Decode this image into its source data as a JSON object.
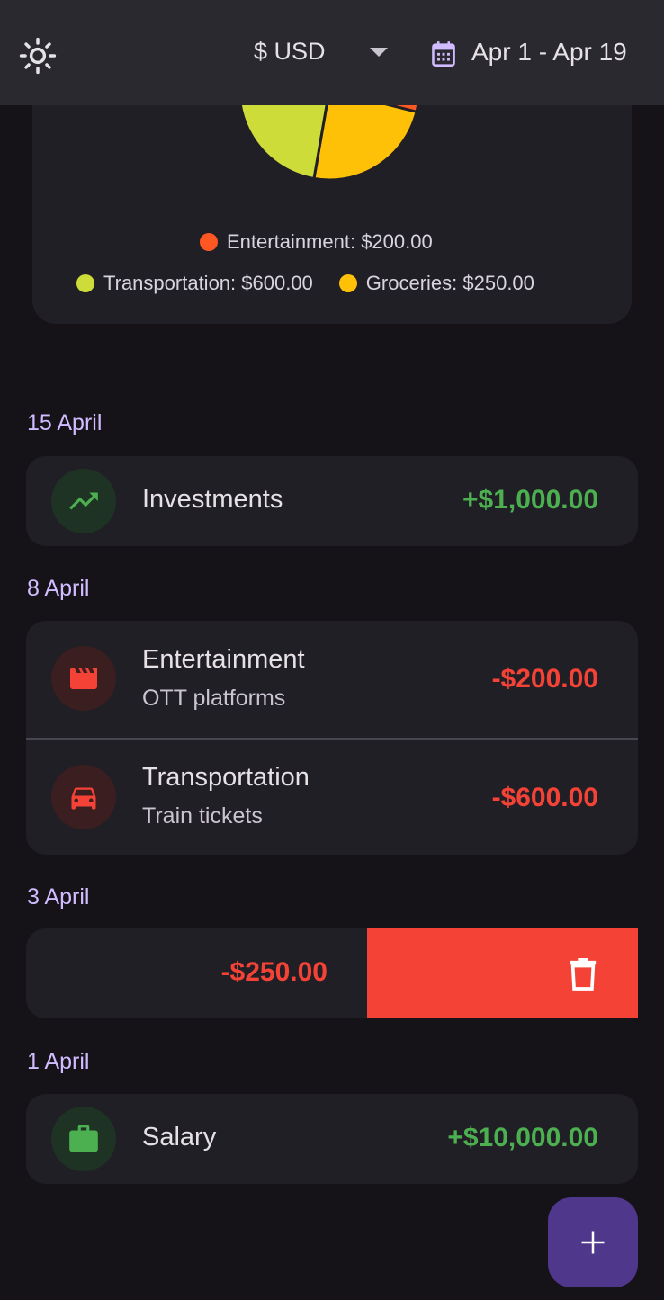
{
  "header": {
    "currency": "$ USD",
    "date_range": "Apr 1 - Apr 19",
    "icons": {
      "theme": "sun-icon",
      "dropdown": "chevron-down-icon",
      "calendar": "calendar-icon"
    }
  },
  "chart_data": {
    "type": "pie",
    "slices": [
      {
        "label": "Entertainment",
        "value": 200,
        "color": "#ff5722"
      },
      {
        "label": "Transportation",
        "value": 600,
        "color": "#cddc39"
      },
      {
        "label": "Groceries",
        "value": 250,
        "color": "#ffc107"
      }
    ],
    "legend": [
      {
        "text": "Entertainment: $200.00",
        "color": "#ff5722"
      },
      {
        "text": "Transportation: $600.00",
        "color": "#cddc39"
      },
      {
        "text": "Groceries: $250.00",
        "color": "#ffc107"
      }
    ]
  },
  "sections": [
    {
      "date": "15 April",
      "items": [
        {
          "title": "Investments",
          "subtitle": "",
          "amount": "+$1,000.00",
          "type": "income",
          "icon": "trending-up-icon"
        }
      ]
    },
    {
      "date": "8 April",
      "items": [
        {
          "title": "Entertainment",
          "subtitle": "OTT platforms",
          "amount": "-$200.00",
          "type": "expense",
          "icon": "movie-clapper-icon"
        },
        {
          "title": "Transportation",
          "subtitle": "Train tickets",
          "amount": "-$600.00",
          "type": "expense",
          "icon": "car-icon"
        }
      ]
    },
    {
      "date": "3 April",
      "items": [
        {
          "title": "",
          "subtitle": "",
          "amount": "-$250.00",
          "type": "expense",
          "icon": "delete-icon",
          "swiped": true
        }
      ]
    },
    {
      "date": "1 April",
      "items": [
        {
          "title": "Salary",
          "subtitle": "",
          "amount": "+$10,000.00",
          "type": "income",
          "icon": "briefcase-icon"
        }
      ]
    }
  ],
  "colors": {
    "income": "#4caf50",
    "expense": "#f44336",
    "accent": "#d0bcff",
    "fab": "#4f378b"
  },
  "fab": {
    "icon": "plus-icon"
  }
}
